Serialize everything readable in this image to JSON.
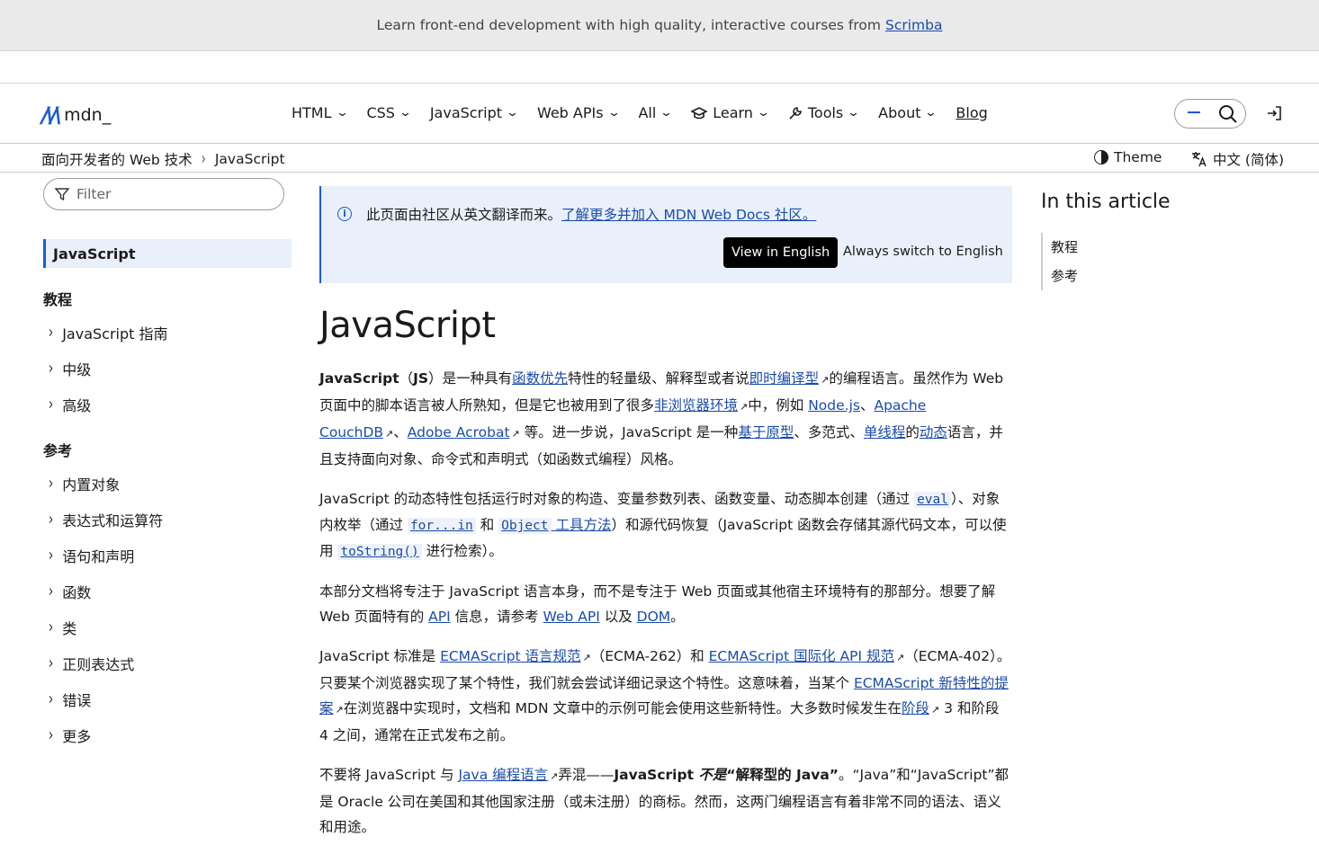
{
  "promo": {
    "text": "Learn front-end development with high quality, interactive courses from",
    "link": "Scrimba"
  },
  "header": {
    "logo_word": "mdn",
    "menu": [
      {
        "label": "HTML",
        "chev": "⌄"
      },
      {
        "label": "CSS",
        "chev": "⌄"
      },
      {
        "label": "JavaScript",
        "chev": "⌄"
      },
      {
        "label": "Web APIs",
        "chev": "⌄"
      },
      {
        "label": "All",
        "chev": "⌄"
      },
      {
        "label": "Learn",
        "chev": "⌄",
        "icon": "graduation-cap-icon"
      },
      {
        "label": "Tools",
        "chev": "⌄",
        "icon": "wrench-icon"
      },
      {
        "label": "About",
        "chev": "⌄"
      }
    ],
    "blog": "Blog"
  },
  "breadcrumb": {
    "parent": "面向开发者的 Web 技术",
    "current": "JavaScript"
  },
  "theme_label": "Theme",
  "lang_label": "中文 (简体)",
  "sidebar": {
    "filter_placeholder": "Filter",
    "active": "JavaScript",
    "section1": "教程",
    "section1_items": [
      "JavaScript 指南",
      "中级",
      "高级"
    ],
    "section2": "参考",
    "section2_items": [
      "内置对象",
      "表达式和运算符",
      "语句和声明",
      "函数",
      "类",
      "正则表达式",
      "错误",
      "更多"
    ]
  },
  "notice": {
    "message": "此页面由社区从英文翻译而来。",
    "link": "了解更多并加入 MDN Web Docs 社区。",
    "view_english": "View in English",
    "always_switch": "Always switch to English"
  },
  "article": {
    "title": "JavaScript",
    "p1": {
      "t1": "JavaScript",
      "t2": "（",
      "t3": "JS",
      "t4": "）是一种具有",
      "l1": "函数优先",
      "t5": "特性的轻量级、解释型或者说",
      "l2": "即时编译型",
      "t6": "的编程语言。虽然作为 Web 页面中的脚本语言被人所熟知，但是它也被用到了很多",
      "l3": "非浏览器环境",
      "t7": "中，例如 ",
      "l4": "Node.js",
      "t8": "、",
      "l5": "Apache CouchDB",
      "t9": "、",
      "l6": "Adobe Acrobat",
      "t10": " 等。进一步说，JavaScript 是一种",
      "l7": "基于原型",
      "t11": "、多范式、",
      "l8": "单线程",
      "t12": "的",
      "l9": "动态",
      "t13": "语言，并且支持面向对象、命令式和声明式（如函数式编程）风格。"
    },
    "p2": {
      "t1": "JavaScript 的动态特性包括运行时对象的构造、变量参数列表、函数变量、动态脚本创建（通过 ",
      "c1": "eval",
      "t2": "）、对象内枚举（通过 ",
      "c2": "for...in",
      "t3": " 和 ",
      "c3": "Object",
      "l1": " 工具方法",
      "t4": "）和源代码恢复（JavaScript 函数会存储其源代码文本，可以使用 ",
      "c4": "toString()",
      "t5": " 进行检索）。"
    },
    "p3": {
      "t1": "本部分文档将专注于 JavaScript 语言本身，而不是专注于 Web 页面或其他宿主环境特有的那部分。想要了解 Web 页面特有的 ",
      "l1": "API",
      "t2": " 信息，请参考 ",
      "l2": "Web API",
      "t3": " 以及 ",
      "l3": "DOM",
      "t4": "。"
    },
    "p4": {
      "t1": "JavaScript 标准是 ",
      "l1": "ECMAScript 语言规范",
      "t2": "（ECMA-262）和 ",
      "l2": "ECMAScript 国际化 API 规范",
      "t3": "（ECMA-402）。只要某个浏览器实现了某个特性，我们就会尝试详细记录这个特性。这意味着，当某个 ",
      "l3": "ECMAScript 新特性的提案",
      "t4": "在浏览器中实现时，文档和 MDN 文章中的示例可能会使用这些新特性。大多数时候发生在",
      "l4": "阶段",
      "t5": " 3 和阶段 4 之间，通常在正式发布之前。"
    },
    "p5": {
      "t1": "不要将 JavaScript 与 ",
      "l1": "Java 编程语言",
      "t2": "弄混——",
      "b1": "JavaScript ",
      "b2": "不是",
      "b3": "“解释型的 Java”",
      "t3": "。“Java”和“JavaScript”都是 Oracle 公司在美国和其他国家注册（或未注册）的商标。然而，这两门编程语言有着非常不同的语法、语义和用途。"
    }
  },
  "toc": {
    "title": "In this article",
    "items": [
      "教程",
      "参考"
    ]
  }
}
